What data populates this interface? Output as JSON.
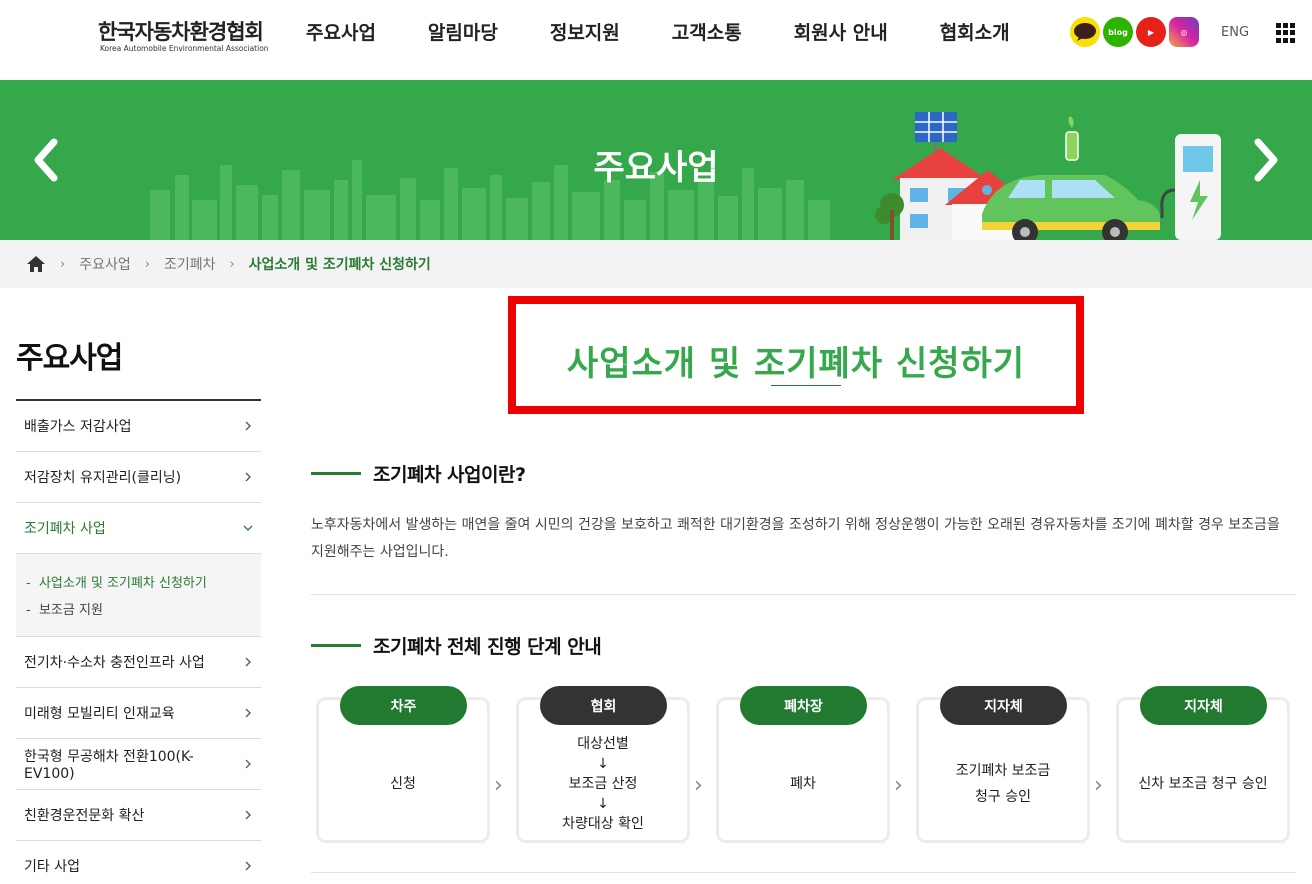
{
  "header": {
    "logo_ko": "한국자동차환경협회",
    "logo_en": "Korea Automobile Environmental Association",
    "nav": [
      "주요사업",
      "알림마당",
      "정보지원",
      "고객소통",
      "회원사 안내",
      "협회소개"
    ],
    "sns": [
      {
        "icon": "kakaotalk-icon",
        "label": "TALK"
      },
      {
        "icon": "blog-icon",
        "label": "blog"
      },
      {
        "icon": "youtube-icon",
        "label": "▶"
      },
      {
        "icon": "instagram-icon",
        "label": "◎"
      }
    ],
    "lang": "ENG"
  },
  "banner": {
    "title": "주요사업",
    "color": "#34a84a"
  },
  "breadcrumb": {
    "items": [
      "주요사업",
      "조기폐차"
    ],
    "current": "사업소개 및 조기폐차 신청하기"
  },
  "lnb": {
    "title": "주요사업",
    "items": [
      {
        "label": "배출가스 저감사업"
      },
      {
        "label": "저감장치 유지관리(클리닝)"
      },
      {
        "label": "조기폐차 사업"
      },
      {
        "label": "전기차·수소차 충전인프라 사업"
      },
      {
        "label": "미래형 모빌리티 인재교육"
      },
      {
        "label": "한국형 무공해차 전환100(K-EV100)"
      },
      {
        "label": "친환경운전문화 확산"
      },
      {
        "label": "기타 사업"
      }
    ],
    "sub_items": [
      "사업소개 및 조기폐차 신청하기",
      "보조금 지원"
    ]
  },
  "main": {
    "page_title": "사업소개 및 조기폐차 신청하기",
    "section1_title": "조기폐차 사업이란?",
    "section1_desc": "노후자동차에서 발생하는 매연을 줄여 시민의 건강을 보호하고 쾌적한 대기환경을 조성하기 위해 정상운행이 가능한 오래된 경유자동차를 조기에 폐차할 경우 보조금을 지원해주는 사업입니다.",
    "section2_title": "조기폐차 전체 진행 단계 안내",
    "steps": [
      {
        "badge": "차주",
        "lines": [
          "신청"
        ]
      },
      {
        "badge": "협회",
        "lines": [
          "대상선별",
          "↓",
          "보조금 산정",
          "↓",
          "차량대상 확인"
        ]
      },
      {
        "badge": "폐차장",
        "lines": [
          "폐차"
        ]
      },
      {
        "badge": "지자체",
        "lines": [
          "조기폐차 보조금",
          "청구 승인"
        ]
      },
      {
        "badge": "지자체",
        "lines": [
          "신차 보조금 청구 승인"
        ]
      }
    ]
  },
  "colors": {
    "brand_green": "#34a84a",
    "dark_green": "#217a2f",
    "highlight_red": "#ee0000"
  }
}
